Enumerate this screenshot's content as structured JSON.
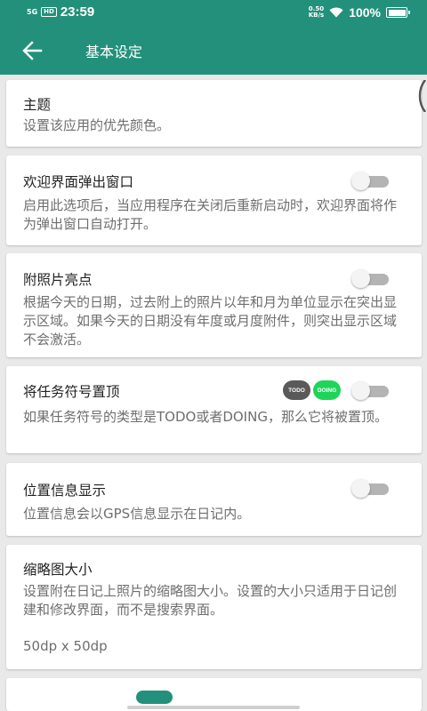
{
  "status_bar": {
    "signal": "5G",
    "hd": "HD",
    "time": "23:59",
    "speed_value": "0.50",
    "speed_unit": "KB/s",
    "battery": "100%"
  },
  "toolbar": {
    "title": "基本设定"
  },
  "settings": {
    "theme": {
      "title": "主题",
      "desc": "设置该应用的优先颜色。"
    },
    "welcome_popup": {
      "title": "欢迎界面弹出窗口",
      "desc": "启用此选项后，当应用程序在关闭后重新启动时，欢迎界面将作为弹出窗口自动打开。",
      "enabled": false
    },
    "photo_highlight": {
      "title": "附照片亮点",
      "desc": "根据今天的日期，过去附上的照片以年和月为单位显示在突出显示区域。如果今天的日期没有年度或月度附件，则突出显示区域不会激活。",
      "enabled": false
    },
    "task_symbol_top": {
      "title": "将任务符号置顶",
      "desc": "如果任务符号的类型是TODO或者DOING，那么它将被置顶。",
      "badge_todo": "TODO",
      "badge_doing": "DOING",
      "enabled": false
    },
    "location_display": {
      "title": "位置信息显示",
      "desc": "位置信息会以GPS信息显示在日记内。",
      "enabled": false
    },
    "thumbnail_size": {
      "title": "缩略图大小",
      "desc": "设置附在日记上照片的缩略图大小。设置的大小只适用于日记创建和修改界面，而不是搜索界面。",
      "value": "50dp x 50dp"
    }
  },
  "pager": {
    "count": 6,
    "active_index": 0
  },
  "colors": {
    "primary": "#23907b",
    "background": "#e9e9e9",
    "todo_badge": "#5a5a5a",
    "doing_badge": "#1fd45a"
  }
}
